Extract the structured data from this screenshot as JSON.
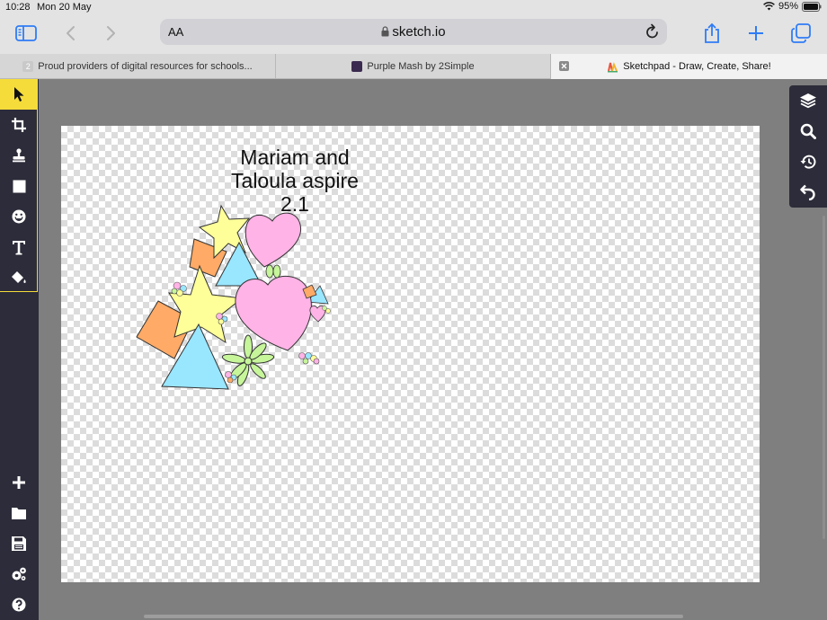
{
  "status": {
    "time": "10:28",
    "date": "Mon 20 May",
    "battery": "95%"
  },
  "browser": {
    "url_size_label": "AA",
    "host": "sketch.io",
    "tabs": [
      {
        "label": "Proud providers of digital resources for schools..."
      },
      {
        "label": "Purple Mash by 2Simple"
      },
      {
        "label": "Sketchpad - Draw, Create, Share!"
      }
    ]
  },
  "canvas": {
    "caption_line1": "Mariam and",
    "caption_line2": "Taloula aspire 2.1"
  },
  "colors": {
    "accent": "#f5dc3a",
    "tool_panel": "#2c2c3a",
    "heart": "#ffb3e6",
    "star": "#ffff99",
    "square": "#ffaa66",
    "triangle": "#99e6ff",
    "flower": "#c6f59a"
  },
  "tools": {
    "left_top": [
      "select-icon",
      "crop-icon",
      "stamp-icon",
      "shape-icon",
      "emoji-icon",
      "text-icon",
      "fill-icon"
    ],
    "left_bottom": [
      "add-icon",
      "folder-icon",
      "save-icon",
      "settings-icon",
      "help-icon"
    ],
    "right": [
      "layers-icon",
      "zoom-icon",
      "history-icon",
      "undo-icon"
    ]
  }
}
